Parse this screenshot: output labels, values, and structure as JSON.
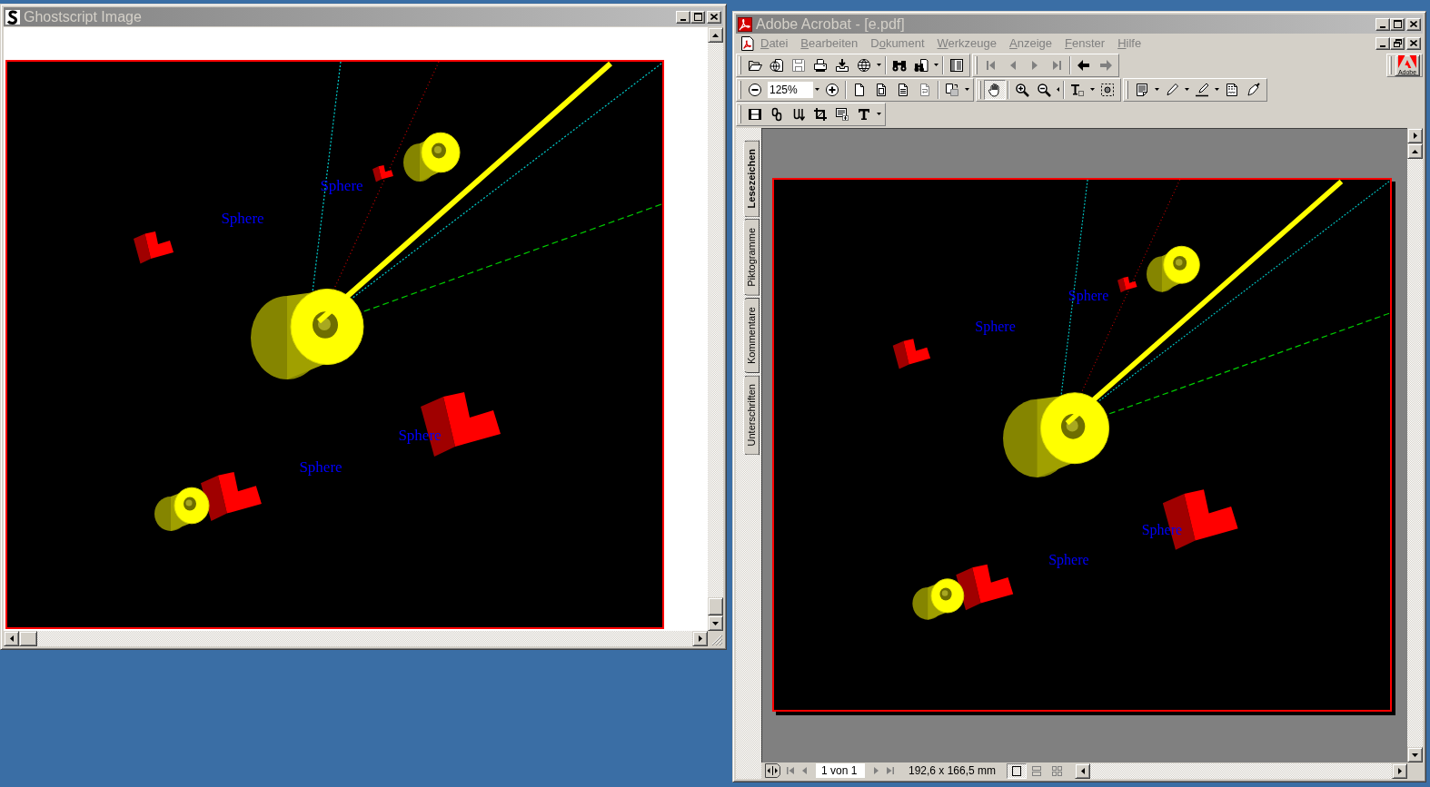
{
  "ghostscript_window": {
    "title": "Ghostscript Image",
    "image": {
      "labels": [
        "Sphere",
        "Sphere",
        "Sphere",
        "Sphere"
      ]
    }
  },
  "acrobat_window": {
    "title": "Adobe Acrobat - [e.pdf]",
    "menu": [
      {
        "access_key": "D",
        "rest": "atei",
        "disabled": true
      },
      {
        "access_key": "B",
        "rest": "earbeiten",
        "disabled": true
      },
      {
        "lead": "D",
        "access_key": "o",
        "rest": "kument",
        "disabled": true
      },
      {
        "access_key": "W",
        "rest": "erkzeuge",
        "disabled": true
      },
      {
        "access_key": "A",
        "rest": "nzeige",
        "disabled": true
      },
      {
        "access_key": "F",
        "rest": "enster",
        "disabled": true
      },
      {
        "access_key": "H",
        "rest": "ilfe",
        "disabled": true
      }
    ],
    "toolbars": [
      {
        "buttons": [
          {
            "disabled": false
          },
          {
            "disabled": false
          },
          {
            "disabled": true
          },
          {
            "disabled": false
          },
          {
            "disabled": false
          },
          {
            "disabled": false
          },
          {
            "disabled": false
          },
          {
            "disabled": false
          },
          {
            "disabled": false
          },
          {
            "disabled": true
          },
          {
            "disabled": true
          },
          {
            "disabled": true
          },
          {
            "disabled": true
          },
          {
            "disabled": false
          },
          {
            "disabled": true
          }
        ]
      },
      {
        "zoom_field": {
          "value": "125%"
        },
        "buttons": [
          {
            "disabled": false
          },
          {
            "disabled": false
          },
          {
            "disabled": false
          },
          {
            "disabled": false
          },
          {
            "disabled": false
          },
          {
            "disabled": true
          },
          {
            "disabled": false
          },
          {
            "disabled": false,
            "selected": true
          },
          {
            "disabled": false,
            "selected": false
          },
          {
            "disabled": false,
            "selected": false
          },
          {
            "disabled": false,
            "selected": false
          },
          {
            "disabled": false,
            "selected": false
          },
          {
            "disabled": false,
            "selected": false
          },
          {
            "disabled": false,
            "selected": false
          },
          {
            "disabled": false,
            "selected": false
          },
          {
            "disabled": false
          },
          {
            "disabled": false,
            "selected": false
          }
        ]
      },
      {
        "buttons": [
          {
            "disabled": false,
            "selected": false
          },
          {
            "disabled": false,
            "selected": false
          },
          {
            "disabled": false,
            "selected": false
          },
          {
            "disabled": false,
            "selected": false
          },
          {
            "disabled": false,
            "selected": false
          },
          {
            "disabled": false,
            "selected": false
          }
        ]
      }
    ],
    "logo": {
      "text": "Adobe"
    },
    "side_tabs": [
      {
        "label": "Lesezeichen",
        "selected": true
      },
      {
        "label": "Piktogramme",
        "selected": false
      },
      {
        "label": "Kommentare",
        "selected": false
      },
      {
        "label": "Unterschriften",
        "selected": false
      }
    ],
    "page": {
      "labels": [
        "Sphere",
        "Sphere",
        "Sphere",
        "Sphere"
      ]
    },
    "status_bar": {
      "page_buttons": [
        {
          "disabled": true
        },
        {
          "disabled": true
        },
        {
          "disabled": true
        },
        {
          "disabled": true
        }
      ],
      "page_field": {
        "value": "1 von 1"
      },
      "page_size": "192,6 x 166,5 mm",
      "view_modes": [
        {
          "selected": true
        },
        {
          "selected": false
        },
        {
          "selected": false
        }
      ]
    }
  }
}
